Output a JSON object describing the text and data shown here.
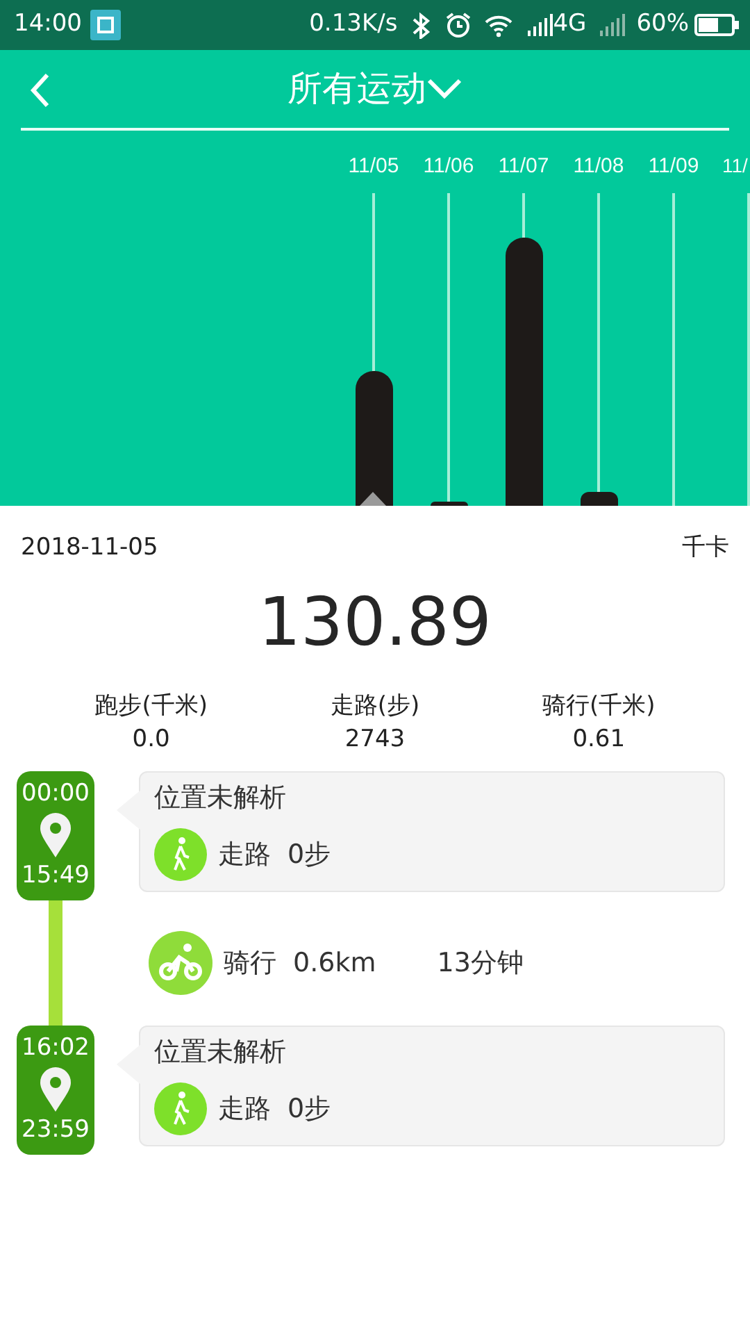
{
  "status_bar": {
    "time": "14:00",
    "net_speed": "0.13K/s",
    "network": "4G",
    "battery": "60%"
  },
  "header": {
    "title": "所有运动"
  },
  "days": [
    {
      "label": "11/05",
      "selected": true
    },
    {
      "label": "11/06",
      "selected": false
    },
    {
      "label": "11/07",
      "selected": false
    },
    {
      "label": "11/08",
      "selected": false
    },
    {
      "label": "11/09",
      "selected": false
    },
    {
      "label": "11/",
      "selected": false
    }
  ],
  "summary": {
    "date": "2018-11-05",
    "unit": "千卡",
    "value": "130.89"
  },
  "stats": [
    {
      "label": "跑步(千米)",
      "value": "0.0"
    },
    {
      "label": "走路(步)",
      "value": "2743"
    },
    {
      "label": "骑行(千米)",
      "value": "0.61"
    }
  ],
  "timeline": [
    {
      "kind": "stop",
      "start": "00:00",
      "end": "15:49",
      "place": "位置未解析",
      "activity": "走路",
      "amount": "0步"
    },
    {
      "kind": "move",
      "activity": "骑行",
      "distance": "0.6km",
      "duration": "13分钟"
    },
    {
      "kind": "stop",
      "start": "16:02",
      "end": "23:59",
      "place": "位置未解析",
      "activity": "走路",
      "amount": "0步"
    }
  ]
}
